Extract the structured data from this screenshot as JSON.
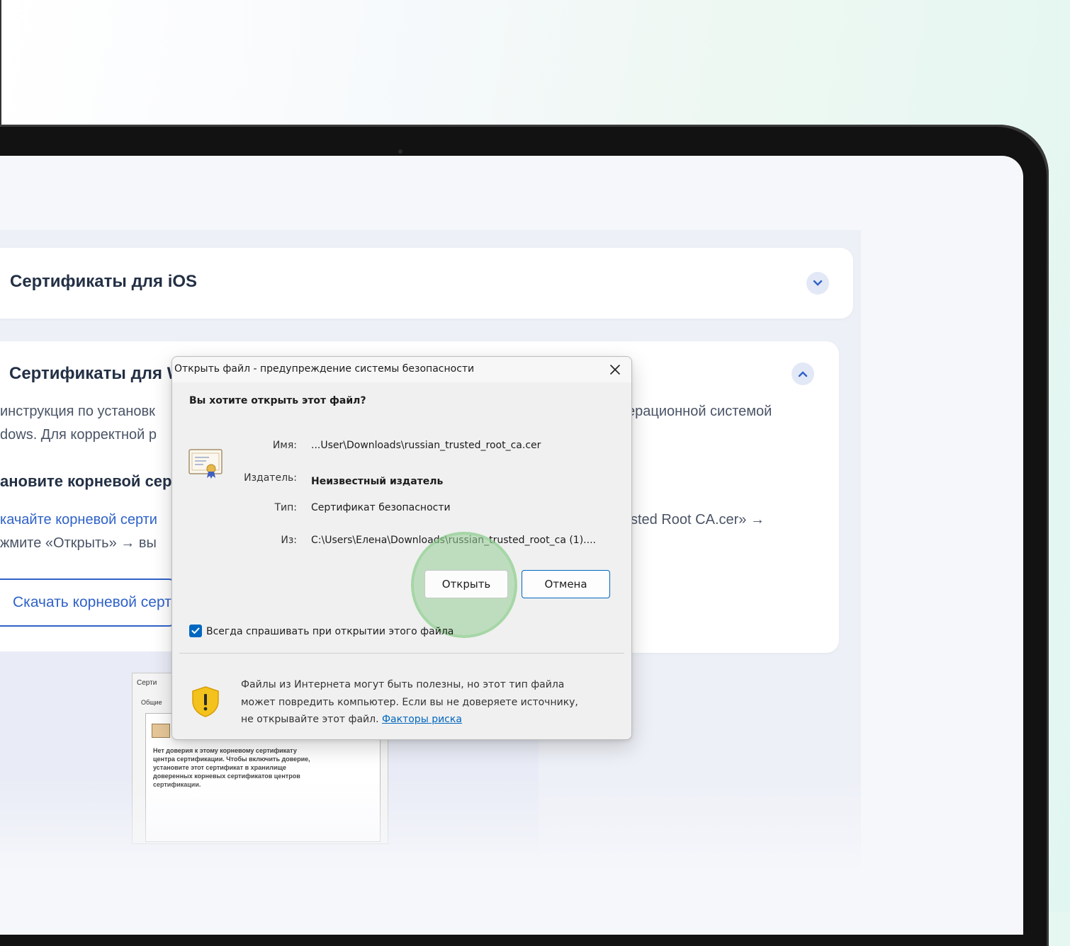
{
  "ios_card": {
    "title": "Сертификаты для iOS"
  },
  "windows_card": {
    "title": "Сертификаты для W",
    "intro_line1_left": "инструкция по установк",
    "intro_line1_right": "ерационной системой",
    "intro_line2_left": "dows. Для корректной р",
    "step_title": "ановите корневой сер",
    "step_line1_left": "качайте корневой серти",
    "step_line1_right": "sted Root CA.cer» →",
    "step_line2_left": "жмите «Открыть» → вы",
    "download_button": "Скачать корневой серт"
  },
  "preview_window": {
    "title": "Серти",
    "tab": "Общие",
    "text": "Нет доверия к этому корневому сертификату\nцентра сертификации. Чтобы включить доверие,\nустановите этот сертификат в хранилище\nдоверенных корневых сертификатов центров\nсертификации."
  },
  "dialog": {
    "title": "Открыть файл - предупреждение системы безопасности",
    "question": "Вы хотите открыть этот файл?",
    "fields": [
      {
        "label": "Имя:",
        "value": "...User\\Downloads\\russian_trusted_root_ca.cer"
      },
      {
        "label": "Издатель:",
        "value": "Неизвестный издатель"
      },
      {
        "label": "Тип:",
        "value": "Сертификат безопасности"
      },
      {
        "label": "Из:",
        "value": "C:\\Users\\Елена\\Downloads\\russian_trusted_root_ca (1)...."
      }
    ],
    "open_button": "Открыть",
    "cancel_button": "Отмена",
    "always_ask_label": "Всегда спрашивать при открытии этого файла",
    "always_ask_checked": true,
    "warning_line1": "Файлы из Интернета могут быть полезны, но этот тип файла",
    "warning_line2": "может повредить компьютер. Если вы не доверяете источнику,",
    "warning_line3": "не открывайте этот файл. ",
    "risk_link": "Факторы риска"
  },
  "icons": {
    "close": "close-icon",
    "chevron_down": "chevron-down-icon",
    "chevron_up": "chevron-up-icon",
    "certificate": "certificate-icon",
    "shield": "shield-warning-icon",
    "check": "checkmark-icon"
  },
  "colors": {
    "link_blue": "#2f62c8",
    "windows_accent": "#0067c0",
    "focus_green": "#96cd96"
  }
}
